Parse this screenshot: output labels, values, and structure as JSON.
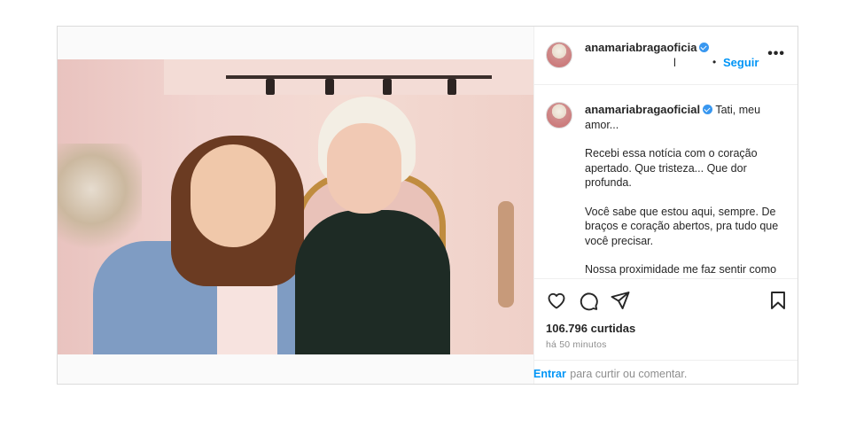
{
  "post": {
    "username": "anamariabragaoficia",
    "username_line2": "l",
    "follow_label": "Seguir",
    "more_icon": "more-options-icon",
    "caption_user": "anamariabragaoficial",
    "caption_first": "Tati, meu amor...",
    "caption_p1": "Recebi essa notícia com o coração apertado. Que tristeza... Que dor profunda.",
    "caption_p2": "Você sabe que estou aqui, sempre. De braços e coração abertos, pra tudo que você precisar.",
    "caption_p3": "Nossa proximidade me faz sentir como se fosse da família – um pouco mãe,",
    "likes": "106.796 curtidas",
    "time": "há 50 minutos",
    "login_link": "Entrar",
    "login_rest": "para curtir ou comentar."
  },
  "colors": {
    "accent": "#0095f6",
    "verified": "#3897f0",
    "text": "#262626",
    "muted": "#8e8e8e"
  }
}
